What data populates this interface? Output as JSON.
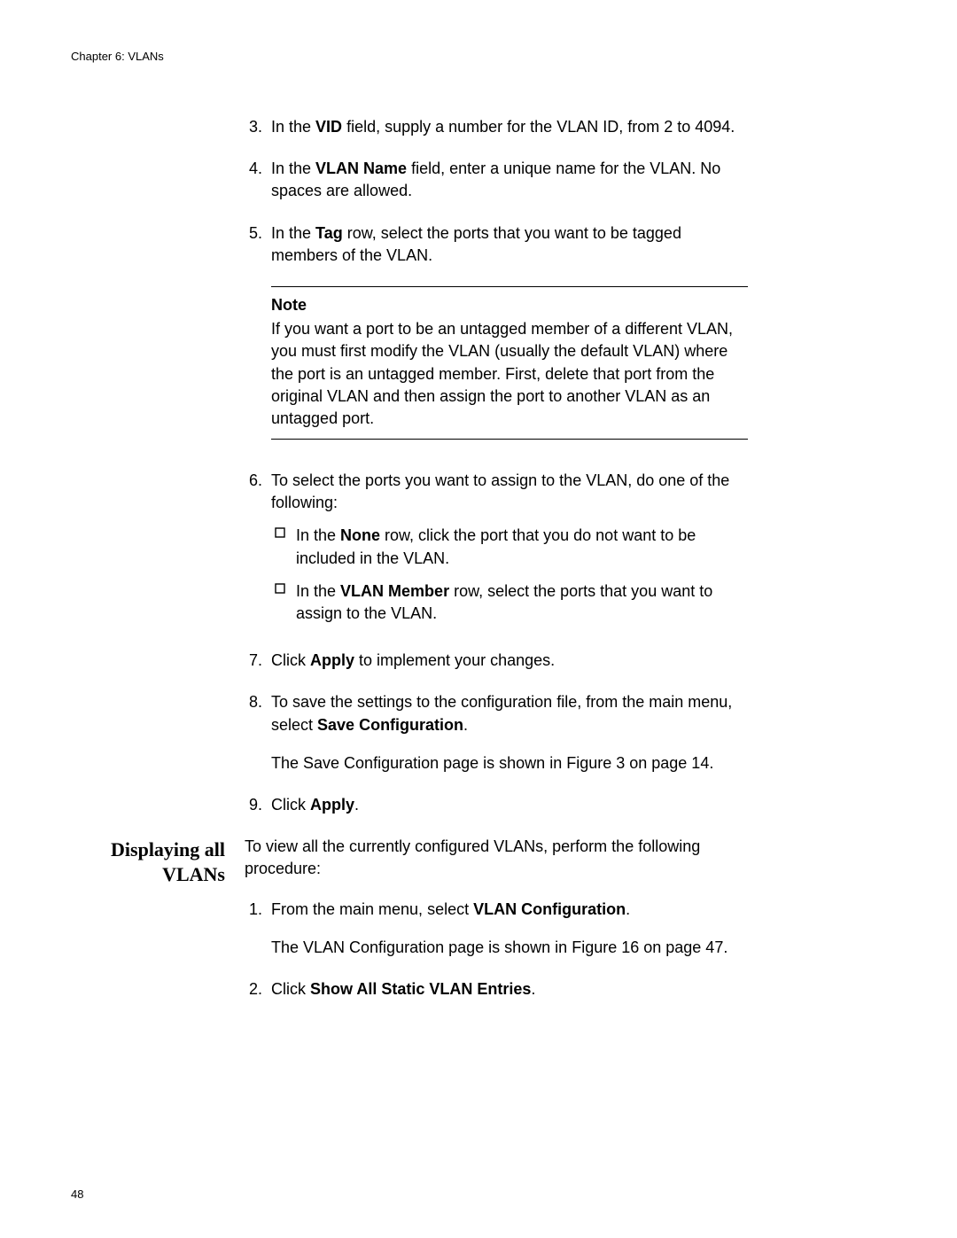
{
  "header": "Chapter 6: VLANs",
  "page_number": "48",
  "steps": {
    "s3": {
      "num": "3.",
      "pre": "In the ",
      "bold": "VID",
      "post": " field, supply a number for the VLAN ID, from 2 to 4094."
    },
    "s4": {
      "num": "4.",
      "pre": "In the ",
      "bold": "VLAN Name",
      "post": " field, enter a unique name for the VLAN. No spaces are allowed."
    },
    "s5": {
      "num": "5.",
      "pre": "In the ",
      "bold": "Tag",
      "post": " row, select the ports that you want to be tagged members of the VLAN."
    },
    "s6": {
      "num": "6.",
      "text": "To select the ports you want to assign to the VLAN, do one of the following:"
    },
    "s6a": {
      "pre": "In the ",
      "bold": "None",
      "post": " row, click the port that you do not want to be included in the VLAN."
    },
    "s6b": {
      "pre": "In the ",
      "bold": "VLAN Member",
      "post": " row, select the ports that you want to assign to the VLAN."
    },
    "s7": {
      "num": "7.",
      "pre": "Click ",
      "bold": "Apply",
      "post": " to implement your changes."
    },
    "s8": {
      "num": "8.",
      "pre": "To save the settings to the configuration file, from the main menu, select ",
      "bold": "Save Configuration",
      "post": ".",
      "after": "The Save Configuration page is shown in Figure 3 on page 14."
    },
    "s9": {
      "num": "9.",
      "pre": "Click ",
      "bold": "Apply",
      "post": "."
    }
  },
  "note": {
    "title": "Note",
    "body": "If you want a port to be an untagged member of a different VLAN, you must first modify the VLAN (usually the default VLAN) where the port is an untagged member. First, delete that port from the original VLAN and then assign the port to another VLAN as an untagged port."
  },
  "section2": {
    "heading": "Displaying all VLANs",
    "intro": "To view all the currently configured VLANs, perform the following procedure:",
    "s1": {
      "num": "1.",
      "pre": "From the main menu, select ",
      "bold": "VLAN Configuration",
      "post": ".",
      "after": "The VLAN Configuration page is shown in Figure 16 on page 47."
    },
    "s2": {
      "num": "2.",
      "pre": "Click ",
      "bold": "Show All Static VLAN Entries",
      "post": "."
    }
  }
}
